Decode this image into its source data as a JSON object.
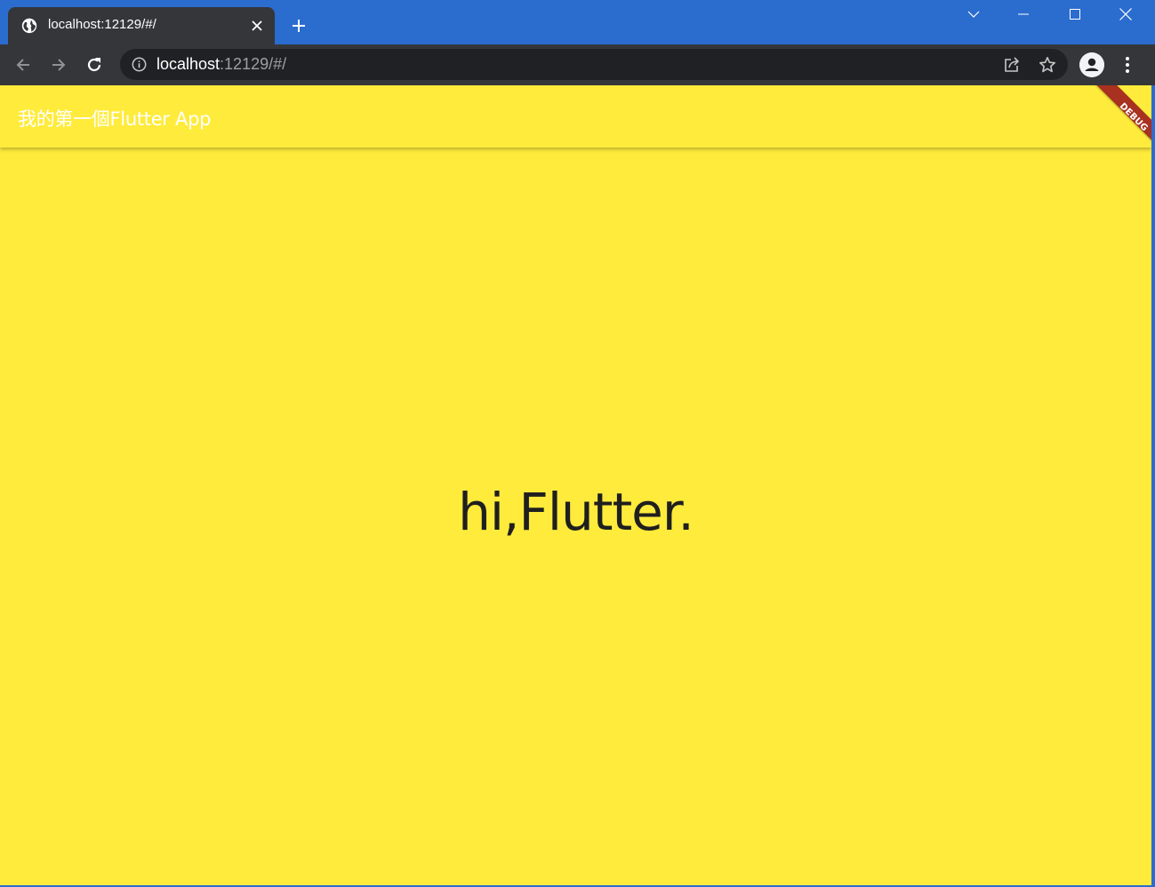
{
  "browser": {
    "tab": {
      "title": "localhost:12129/#/",
      "favicon": "globe-icon"
    },
    "window_controls": [
      "tab-search-icon",
      "minimize-icon",
      "maximize-icon",
      "close-window-icon"
    ],
    "toolbar": {
      "url_host": "localhost",
      "url_rest": ":12129/#/",
      "icons": [
        "back-icon",
        "forward-icon",
        "reload-icon",
        "info-icon",
        "share-icon",
        "star-icon",
        "profile-icon",
        "menu-icon"
      ]
    },
    "colors": {
      "titlebar": "#2b6ccf",
      "tab": "#35363a",
      "omnibox": "#202124"
    }
  },
  "app": {
    "appbar_title": "我的第一個Flutter App",
    "body_text": "hi,Flutter.",
    "debug_banner": "DEBUG",
    "colors": {
      "background": "#ffeb3b",
      "appbar_title": "#ffffff",
      "body_text": "#1f1f1f",
      "debug_banner": "#a8311f"
    }
  }
}
